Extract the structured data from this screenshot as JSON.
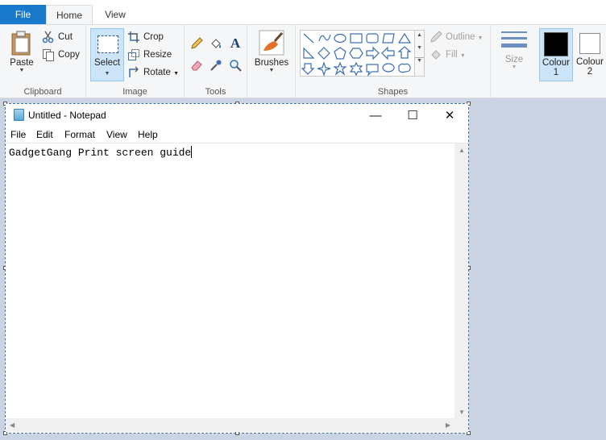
{
  "ribbon": {
    "tabs": {
      "file": "File",
      "home": "Home",
      "view": "View"
    },
    "clipboard": {
      "paste": "Paste",
      "cut": "Cut",
      "copy": "Copy",
      "label": "Clipboard"
    },
    "image": {
      "select": "Select",
      "crop": "Crop",
      "resize": "Resize",
      "rotate": "Rotate",
      "label": "Image"
    },
    "tools": {
      "label": "Tools"
    },
    "brushes": {
      "label": "Brushes"
    },
    "shapes": {
      "outline": "Outline",
      "fill": "Fill",
      "label": "Shapes"
    },
    "size": {
      "label": "Size"
    },
    "colours": {
      "colour1": "Colour 1",
      "colour1_num": "1",
      "colour1_word": "Colour",
      "colour2_word": "Colour",
      "colour2_num": "2",
      "colour1_value": "#000000",
      "colour2_value": "#ffffff"
    }
  },
  "notepad": {
    "title": "Untitled - Notepad",
    "menu": {
      "file": "File",
      "edit": "Edit",
      "format": "Format",
      "view": "View",
      "help": "Help"
    },
    "text": "GadgetGang Print screen guide",
    "controls": {
      "minimize": "—",
      "maximize": "☐",
      "close": "✕"
    }
  },
  "colors": {
    "accent": "#1979ca",
    "selection": "#cce4f7"
  }
}
